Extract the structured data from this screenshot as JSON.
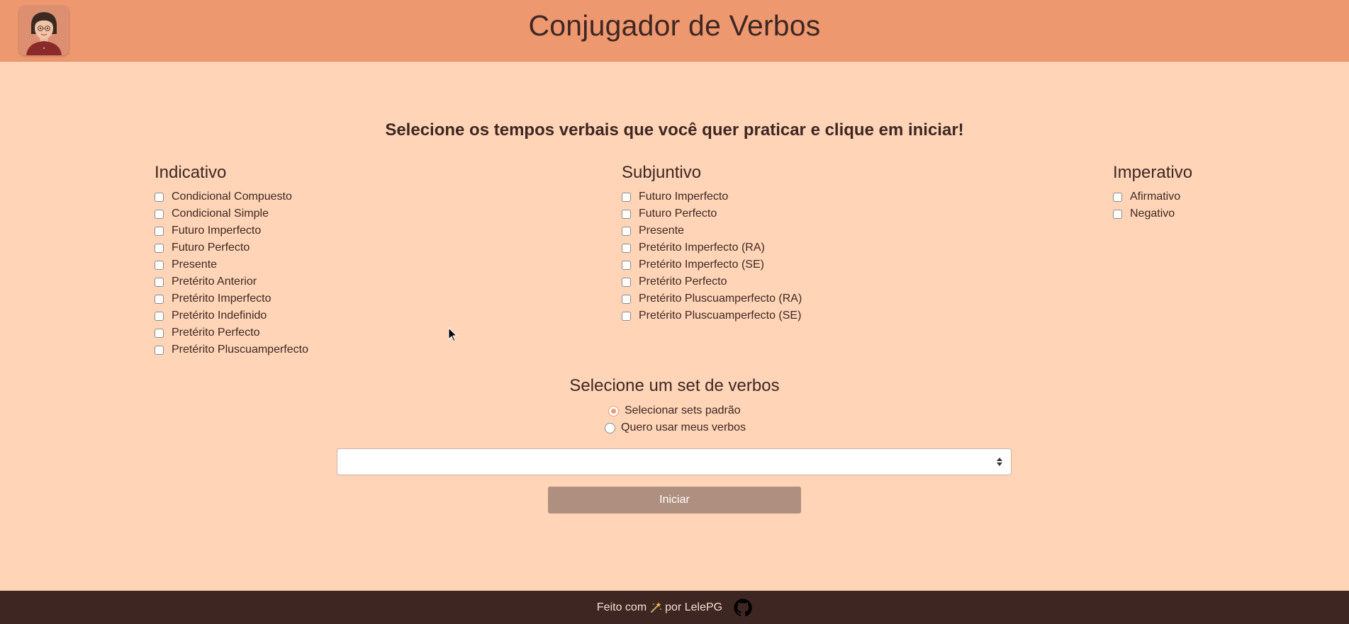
{
  "header": {
    "title": "Conjugador de Verbos"
  },
  "main": {
    "instruction": "Selecione os tempos verbais que você quer praticar e clique em iniciar!",
    "groups": {
      "indicativo": {
        "title": "Indicativo",
        "options": [
          "Condicional Compuesto",
          "Condicional Simple",
          "Futuro Imperfecto",
          "Futuro Perfecto",
          "Presente",
          "Pretérito Anterior",
          "Pretérito Imperfecto",
          "Pretérito Indefinido",
          "Pretérito Perfecto",
          "Pretérito Pluscuamperfecto"
        ]
      },
      "subjuntivo": {
        "title": "Subjuntivo",
        "options": [
          "Futuro Imperfecto",
          "Futuro Perfecto",
          "Presente",
          "Pretérito Imperfecto (RA)",
          "Pretérito Imperfecto (SE)",
          "Pretérito Perfecto",
          "Pretérito Pluscuamperfecto (RA)",
          "Pretérito Pluscuamperfecto (SE)"
        ]
      },
      "imperativo": {
        "title": "Imperativo",
        "options": [
          "Afirmativo",
          "Negativo"
        ]
      }
    },
    "verb_set": {
      "title": "Selecione um set de verbos",
      "options": [
        {
          "label": "Selecionar sets padrão",
          "checked": true
        },
        {
          "label": "Quero usar meus verbos",
          "checked": false
        }
      ],
      "select_value": ""
    },
    "start_label": "Iniciar"
  },
  "footer": {
    "text_before": "Feito com",
    "text_after": "por LelePG",
    "wand_icon": "magic-wand-icon",
    "github_icon": "github-icon"
  },
  "colors": {
    "header_bg": "#ee9870",
    "page_bg": "#ffd4b7",
    "text": "#3e2723",
    "footer_bg": "#3e2723",
    "button_bg": "#af8f7f",
    "accent": "#ee9870"
  }
}
